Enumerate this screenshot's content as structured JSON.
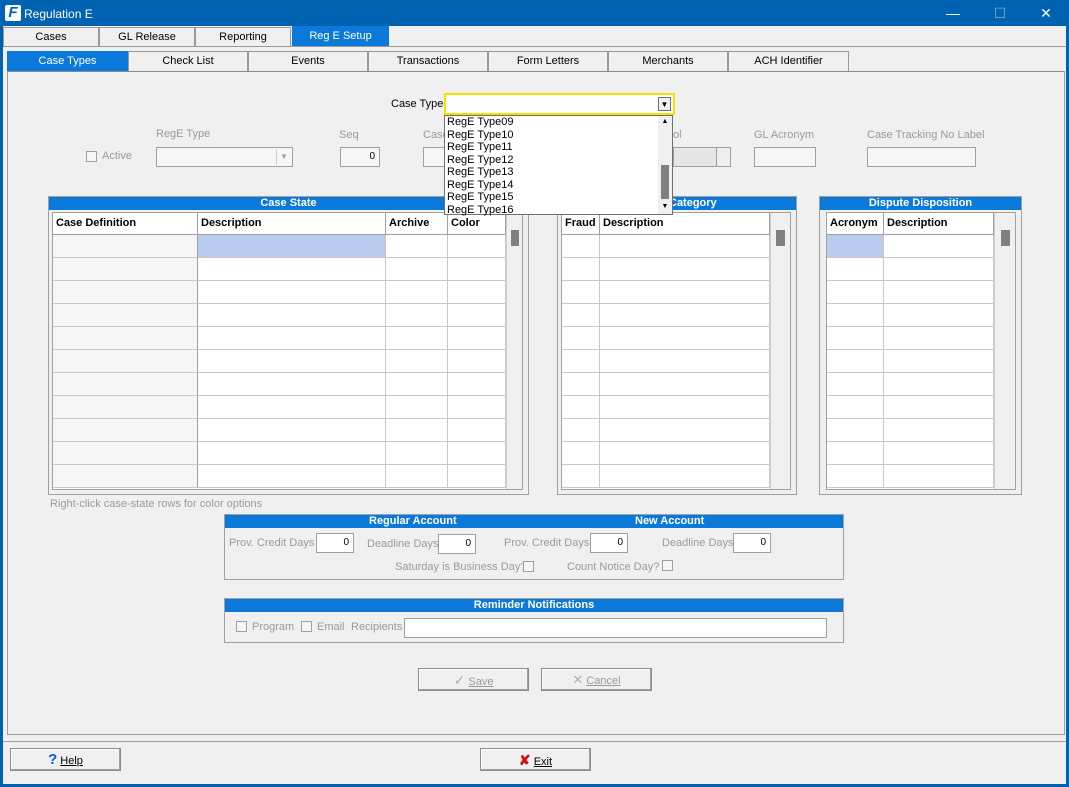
{
  "window": {
    "title": "Regulation E",
    "icon_glyph": "F",
    "min_glyph": "—",
    "max_glyph": "☐",
    "close_glyph": "✕"
  },
  "main_tabs": [
    {
      "label": "Cases"
    },
    {
      "label": "GL Release"
    },
    {
      "label": "Reporting"
    },
    {
      "label": "Reg E Setup",
      "active": true
    }
  ],
  "sub_tabs": [
    {
      "label": "Case Types",
      "active": true
    },
    {
      "label": "Check List"
    },
    {
      "label": "Events"
    },
    {
      "label": "Transactions"
    },
    {
      "label": "Form Letters"
    },
    {
      "label": "Merchants"
    },
    {
      "label": "ACH Identifier"
    }
  ],
  "case_type": {
    "label": "Case Type",
    "value": "",
    "options": [
      "RegE Type09",
      "RegE Type10",
      "RegE Type11",
      "RegE Type12",
      "RegE Type13",
      "RegE Type14",
      "RegE Type15",
      "RegE Type16"
    ]
  },
  "fields": {
    "active_label": "Active",
    "rege_type_label": "RegE Type",
    "seq_label": "Seq",
    "seq_value": "0",
    "case_label": "Case",
    "partial_label": "ol",
    "gl_acronym_label": "GL Acronym",
    "tracking_label": "Case Tracking No Label"
  },
  "case_state": {
    "title": "Case State",
    "columns": [
      "Case Definition",
      "Description",
      "Archive",
      "Color"
    ],
    "hint": "Right-click case-state rows for color options"
  },
  "category": {
    "title": "Category",
    "columns": [
      "Fraud",
      "Description"
    ]
  },
  "dispute": {
    "title": "Dispute Disposition",
    "columns": [
      "Acronym",
      "Description"
    ]
  },
  "accounts": {
    "regular_title": "Regular Account",
    "new_title": "New Account",
    "prov_credit_label": "Prov. Credit Days",
    "deadline_label": "Deadline Days",
    "regular_prov": "0",
    "regular_deadline": "0",
    "new_prov": "0",
    "new_deadline": "0",
    "saturday_label": "Saturday is Business Day?",
    "count_notice_label": "Count Notice Day?"
  },
  "reminder": {
    "title": "Reminder Notifications",
    "program_label": "Program",
    "email_label": "Email",
    "recipients_label": "Recipients"
  },
  "actions": {
    "save_label": "Save",
    "cancel_label": "Cancel",
    "help_label": "Help",
    "exit_label": "Exit"
  },
  "colors": {
    "title_bar": "#0063b1",
    "accent": "#0a79da",
    "combo_focus": "#f4e300",
    "selected_cell": "#b9cbee"
  }
}
